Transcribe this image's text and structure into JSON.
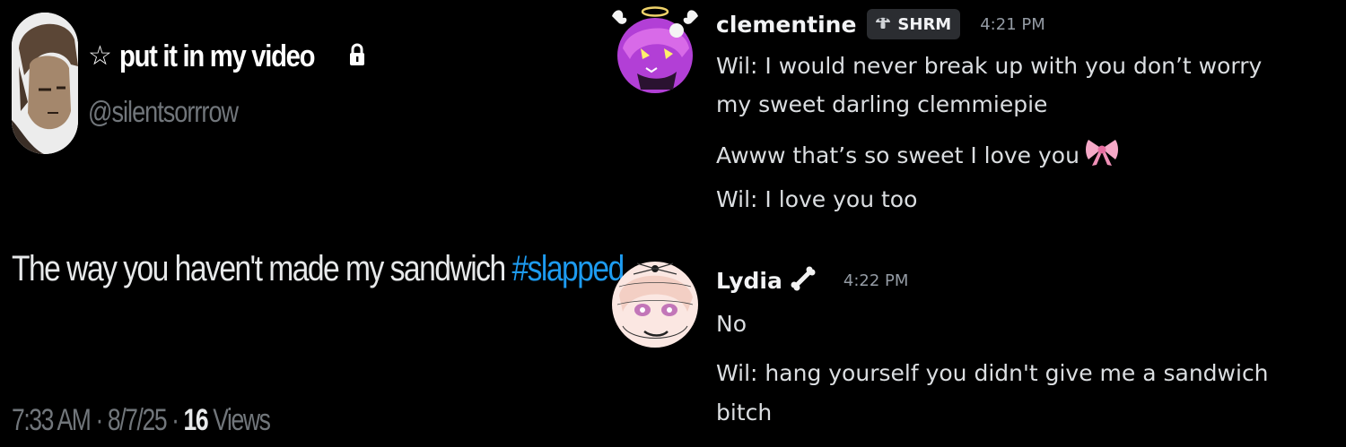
{
  "tweet": {
    "display_name": "put it in my video",
    "handle": "@silentsorrrow",
    "text_before": "The way you haven't made my sandwich ",
    "hashtag": "#slapped",
    "time": "7:33 AM",
    "date": "8/7/25",
    "separator": "·",
    "views_count": "16",
    "views_label": "Views",
    "icons": {
      "star": "star-icon",
      "lock": "lock-icon"
    },
    "colors": {
      "hashtag": "#1d9bf0",
      "muted": "#71767b"
    }
  },
  "chat": {
    "messages": [
      {
        "username": "clementine",
        "badge": "SHRM",
        "badge_icon": "mushroom-icon",
        "timestamp": "4:21 PM",
        "lines": [
          "Wil: I would never break up with you don’t worry",
          "my sweet darling clemmiepie",
          "Awww that’s so sweet I love you",
          "Wil: I love you too"
        ],
        "emoji": "pink-bow-emoji"
      },
      {
        "username": "Lydia",
        "name_icon": "bone-icon",
        "timestamp": "4:22 PM",
        "lines": [
          "No",
          "Wil: hang yourself you didn't give me a sandwich",
          "bitch"
        ]
      }
    ]
  }
}
